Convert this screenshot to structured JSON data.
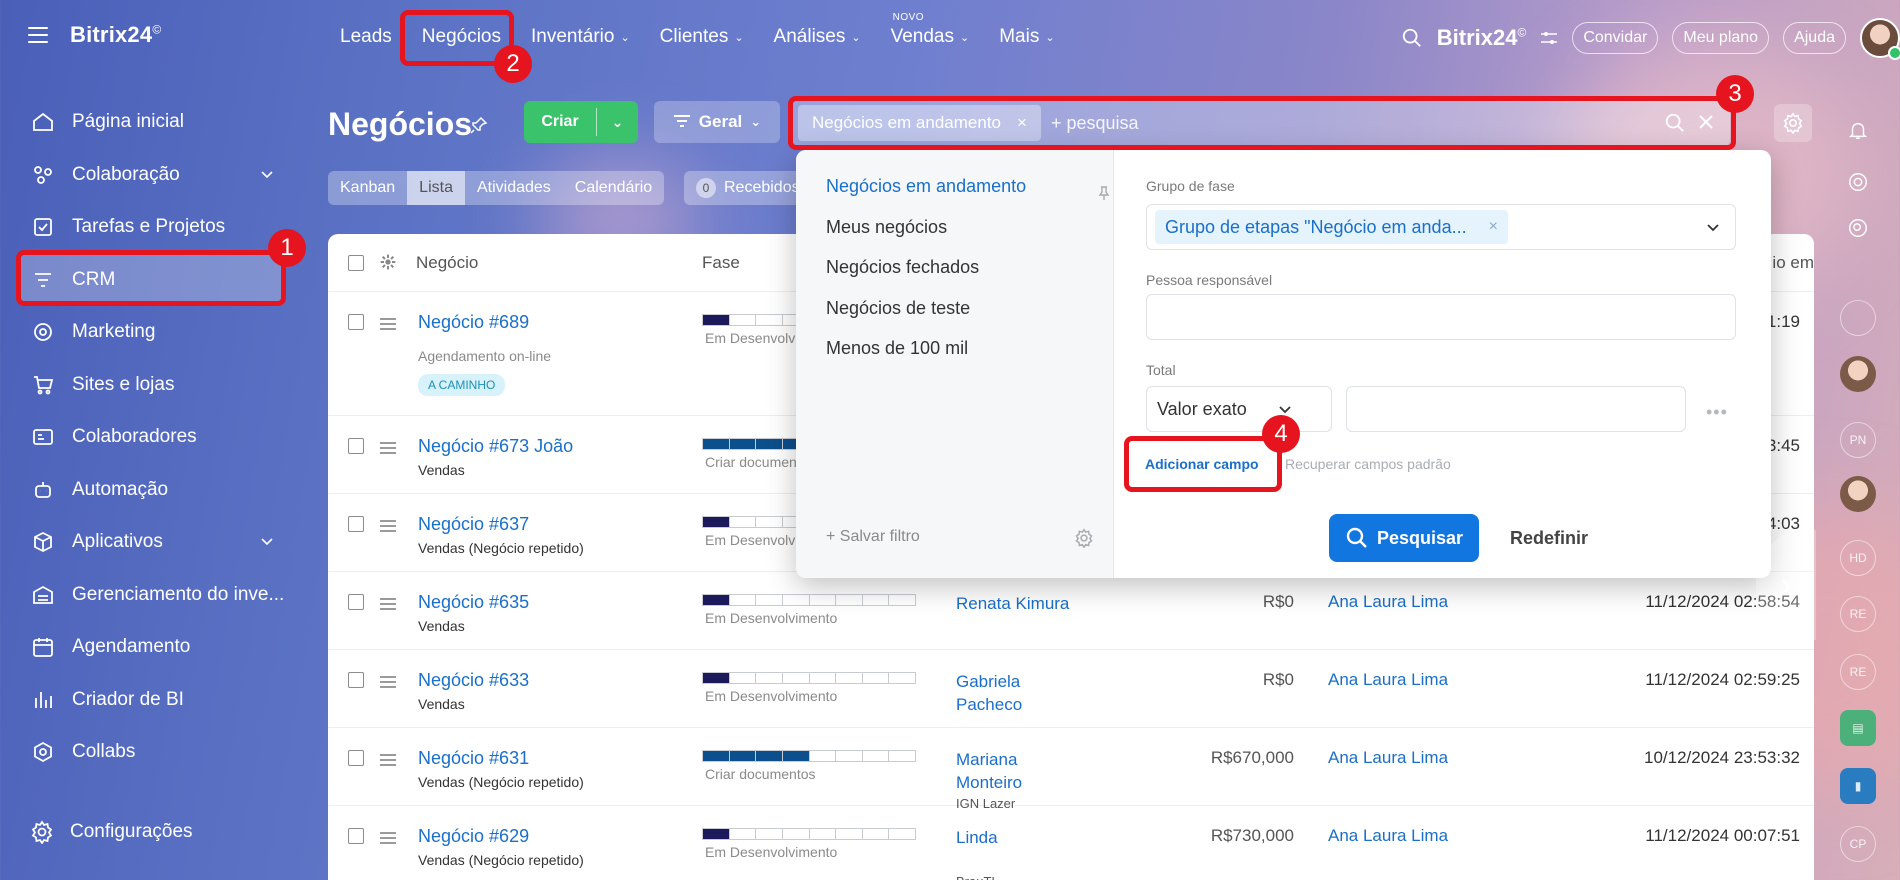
{
  "app": {
    "brand": "Bitrix24",
    "brand_mark": "©"
  },
  "sidebar": {
    "items": [
      {
        "label": "Página inicial",
        "icon": "home-icon"
      },
      {
        "label": "Colaboração",
        "icon": "collab-icon",
        "has_children": true
      },
      {
        "label": "Tarefas e Projetos",
        "icon": "tasks-icon"
      },
      {
        "label": "CRM",
        "icon": "crm-icon",
        "active": true
      },
      {
        "label": "Marketing",
        "icon": "marketing-icon"
      },
      {
        "label": "Sites e lojas",
        "icon": "cart-icon"
      },
      {
        "label": "Colaboradores",
        "icon": "employees-icon"
      },
      {
        "label": "Automação",
        "icon": "robot-icon"
      },
      {
        "label": "Aplicativos",
        "icon": "apps-icon",
        "has_children": true
      },
      {
        "label": "Gerenciamento do inve...",
        "icon": "inventory-icon"
      },
      {
        "label": "Agendamento",
        "icon": "calendar-icon"
      },
      {
        "label": "Criador de BI",
        "icon": "bi-icon"
      },
      {
        "label": "Collabs",
        "icon": "collabs-icon"
      }
    ],
    "settings_label": "Configurações"
  },
  "topnav": {
    "items": [
      {
        "label": "Leads",
        "caret": false
      },
      {
        "label": "Negócios",
        "caret": false
      },
      {
        "label": "Inventário",
        "caret": true
      },
      {
        "label": "Clientes",
        "caret": true
      },
      {
        "label": "Análises",
        "caret": true
      },
      {
        "label": "Vendas",
        "caret": true,
        "badge": "NOVO"
      },
      {
        "label": "Mais",
        "caret": true
      }
    ],
    "right": {
      "brand": "Bitrix24",
      "invite": "Convidar",
      "plan": "Meu plano",
      "help": "Ajuda"
    }
  },
  "page": {
    "title": "Negócios",
    "create_label": "Criar",
    "general_label": "Geral",
    "search": {
      "chip": "Negócios em andamento",
      "placeholder": "+ pesquisa"
    },
    "view_tabs": [
      "Kanban",
      "Lista",
      "Atividades",
      "Calendário"
    ],
    "active_view": "Lista",
    "received": {
      "count": "0",
      "label": "Recebidos"
    }
  },
  "table": {
    "headers": {
      "deal": "Negócio",
      "phase": "Fase",
      "date_partial": "io em"
    },
    "rows": [
      {
        "deal": "Negócio #689",
        "sub": "Agendamento on-line",
        "tag": "A CAMINHO",
        "phase_label": "Em Desenvolvi",
        "phase_fill": 1,
        "contact": "",
        "company": "",
        "amount": "",
        "responsible": "",
        "date": "1:19"
      },
      {
        "deal": "Negócio #673 João",
        "sub": "Vendas",
        "phase_label": "Criar documen",
        "phase_fill": 4,
        "contact": "",
        "company": "",
        "amount": "",
        "responsible": "",
        "date": "3:45"
      },
      {
        "deal": "Negócio #637",
        "sub": "Vendas (Negócio repetido)",
        "phase_label": "Em Desenvolvi",
        "phase_fill": 1,
        "contact": "",
        "company": "",
        "amount": "",
        "responsible": "",
        "date": "4:03"
      },
      {
        "deal": "Negócio #635",
        "sub": "Vendas",
        "phase_label": "Em Desenvolvimento",
        "phase_fill": 1,
        "contact": "Renata Kimura",
        "company": "",
        "amount": "R$0",
        "responsible": "Ana Laura Lima",
        "date": "11/12/2024 02:58:54"
      },
      {
        "deal": "Negócio #633",
        "sub": "Vendas",
        "phase_label": "Em Desenvolvimento",
        "phase_fill": 1,
        "contact": "Gabriela Pacheco",
        "company": "",
        "amount": "R$0",
        "responsible": "Ana Laura Lima",
        "date": "11/12/2024 02:59:25"
      },
      {
        "deal": "Negócio #631",
        "sub": "Vendas (Negócio repetido)",
        "phase_label": "Criar documentos",
        "phase_fill": 4,
        "contact": "Mariana Monteiro",
        "company": "IGN Lazer",
        "amount": "R$670,000",
        "responsible": "Ana Laura Lima",
        "date": "10/12/2024 23:53:32"
      },
      {
        "deal": "Negócio #629",
        "sub": "Vendas (Negócio repetido)",
        "phase_label": "Em Desenvolvimento",
        "phase_fill": 1,
        "contact": "Linda",
        "company": "BrauTI",
        "amount": "R$730,000",
        "responsible": "Ana Laura Lima",
        "date": "11/12/2024 00:07:51"
      }
    ]
  },
  "filter_popup": {
    "presets": [
      "Negócios em andamento",
      "Meus negócios",
      "Negócios fechados",
      "Negócios de teste",
      "Menos de 100 mil"
    ],
    "save_filter": "+ Salvar filtro",
    "fields": {
      "stage_group_label": "Grupo de fase",
      "stage_group_value": "Grupo de etapas \"Negócio em anda...",
      "responsible_label": "Pessoa responsável",
      "total_label": "Total",
      "total_mode": "Valor exato"
    },
    "add_field": "Adicionar campo",
    "restore_fields": "Recuperar campos padrão",
    "search_button": "Pesquisar",
    "reset_button": "Redefinir"
  },
  "annotations": [
    "1",
    "2",
    "3",
    "4"
  ],
  "rail": [
    "PN",
    "HD",
    "RE",
    "RE",
    "CP"
  ],
  "colors": {
    "accent": "#1276e0",
    "create_green": "#3bc36b",
    "highlight_red": "#e5141e",
    "link_blue": "#1a6fc9"
  }
}
